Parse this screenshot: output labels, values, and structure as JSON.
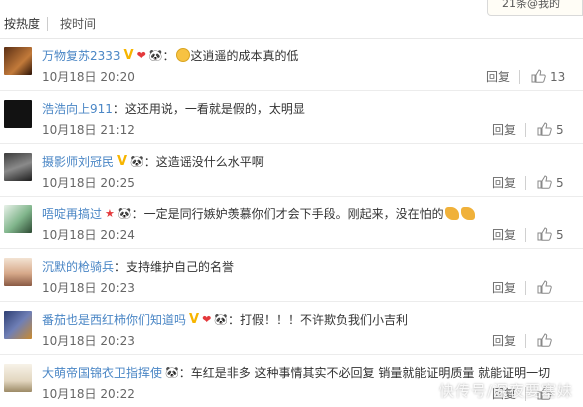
{
  "sort": {
    "hot": "按热度",
    "time": "按时间"
  },
  "notice": "21条@我的",
  "reply_label": "回复",
  "watermark": "快传号/深夜要塞妹",
  "comments": [
    {
      "user": "万物复苏2333",
      "text": "这逍遥的成本真的低",
      "date": "10月18日 20:20",
      "likes": "13"
    },
    {
      "user": "浩浩向上911",
      "text": "：这还用说，一看就是假的，太明显",
      "date": "10月18日 21:12",
      "likes": "5"
    },
    {
      "user": "摄影师刘冠民",
      "text": "：这造谣没什么水平啊",
      "date": "10月18日 20:25",
      "likes": "5"
    },
    {
      "user": "唔啶再搞过",
      "text": "一定是同行嫉妒羡慕你们才会下手段。刚起来，没在怕的",
      "date": "10月18日 20:24",
      "likes": "5"
    },
    {
      "user": "沉默的枪骑兵",
      "text": "：支持维护自己的名誉",
      "date": "10月18日 20:23",
      "likes": ""
    },
    {
      "user": "番茄也是西红柿你们知道吗",
      "text": "：打假！！！不许欺负我们小吉利",
      "date": "10月18日 20:23",
      "likes": ""
    },
    {
      "user": "大萌帝国锦衣卫指挥使",
      "text": "：车红是非多 这种事情其实不必回复 销量就能证明质量 就能证明一切",
      "date": "10月18日 20:22",
      "likes": ""
    }
  ]
}
